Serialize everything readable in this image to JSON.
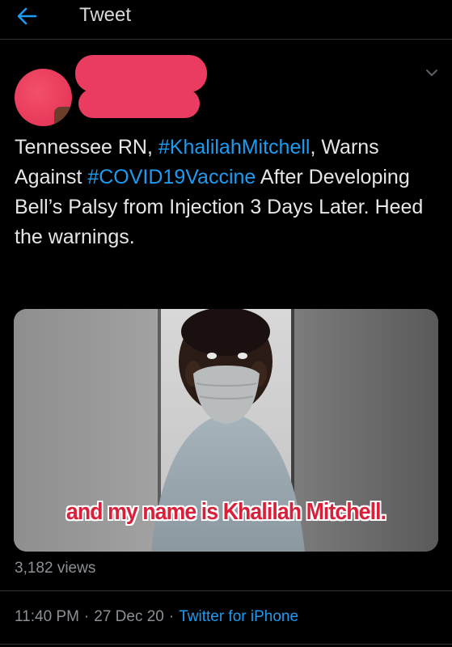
{
  "header": {
    "title": "Tweet",
    "back_icon": "arrow-left-icon"
  },
  "author": {
    "avatar": "avatar (redacted)",
    "more_icon": "chevron-down-icon"
  },
  "tweet": {
    "text_part1": "Tennessee RN, ",
    "hashtag1": "#KhalilahMitchell",
    "text_part2": ", Warns Against ",
    "hashtag2": "#COVID19Vaccine",
    "text_part3": " After Developing Bell’s Palsy from Injection 3 Days Later. Heed the warnings."
  },
  "media": {
    "caption": "and my name is Khalilah Mitchell."
  },
  "stats": {
    "views": "3,182 views"
  },
  "meta": {
    "time": "11:40 PM",
    "separator": "·",
    "date": "27 Dec 20",
    "source": "Twitter for iPhone"
  },
  "colors": {
    "background": "#000000",
    "link": "#1d9bf0",
    "secondary_text": "#8b9096",
    "redaction": "#ea3c60",
    "caption_text": "#d8203a"
  }
}
